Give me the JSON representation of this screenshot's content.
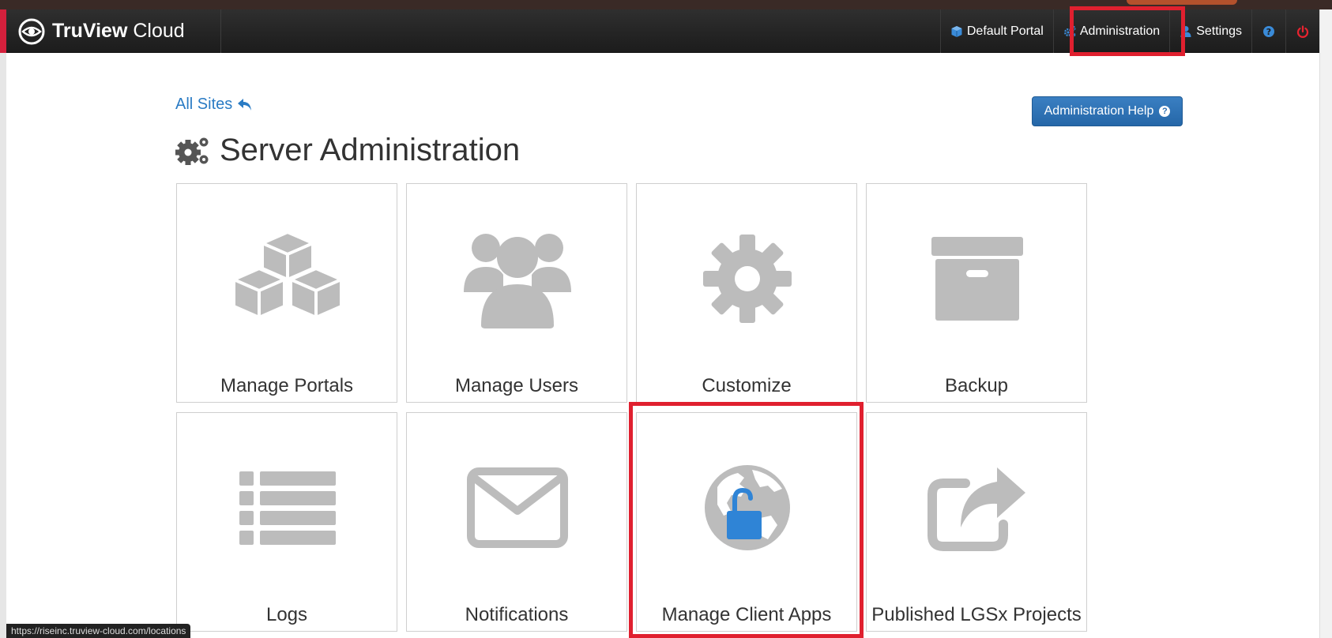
{
  "navbar": {
    "brand_bold": "TruView",
    "brand_light": " Cloud",
    "items": [
      {
        "label": "Default Portal",
        "icon": "cube-icon"
      },
      {
        "label": "Administration",
        "icon": "cogs-icon"
      },
      {
        "label": "Settings",
        "icon": "user-icon"
      },
      {
        "label": "",
        "icon": "help-icon"
      },
      {
        "label": "",
        "icon": "power-icon"
      }
    ]
  },
  "content": {
    "back_link": "All Sites",
    "help_button": "Administration Help",
    "title": "Server Administration"
  },
  "tiles": [
    {
      "label": "Manage Portals",
      "icon": "cubes-icon"
    },
    {
      "label": "Manage Users",
      "icon": "users-icon"
    },
    {
      "label": "Customize",
      "icon": "gear-icon"
    },
    {
      "label": "Backup",
      "icon": "archive-icon"
    },
    {
      "label": "Logs",
      "icon": "list-icon"
    },
    {
      "label": "Notifications",
      "icon": "envelope-icon"
    },
    {
      "label": "Manage Client Apps",
      "icon": "globe-unlock-icon"
    },
    {
      "label": "Published LGSx Projects",
      "icon": "share-icon"
    }
  ],
  "status_bar_url": "https://riseinc.truview-cloud.com/locations",
  "colors": {
    "navbar": "#222222",
    "link": "#2a7bc4",
    "help_button": "#2a6cb0",
    "tile_icon": "#bcbcbc",
    "highlight": "#e0202f",
    "lock": "#2f84d6"
  }
}
